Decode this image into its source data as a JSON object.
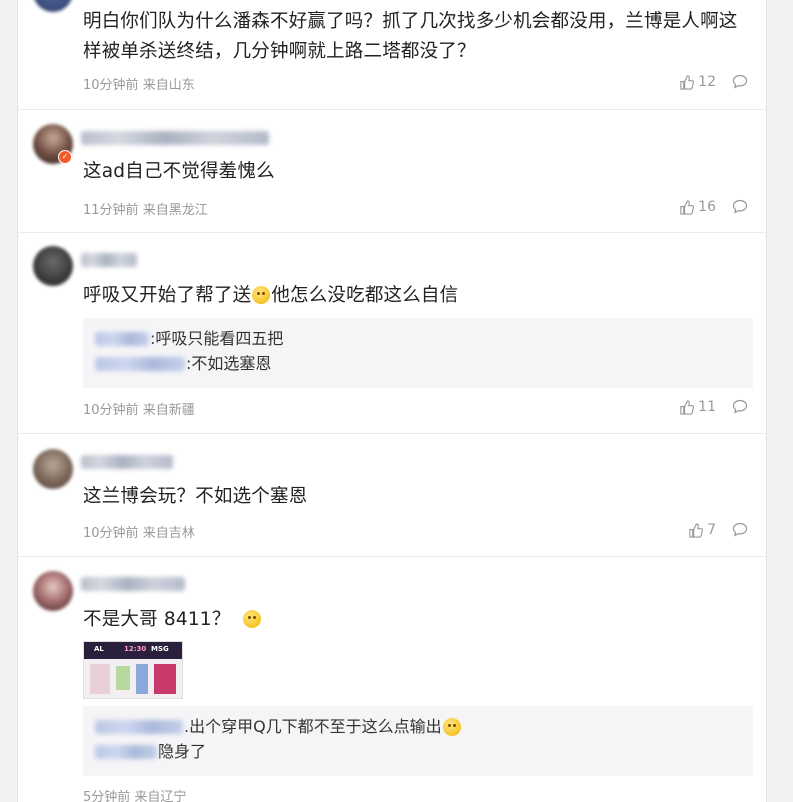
{
  "comments": [
    {
      "text": "明白你们队为什么潘森不好赢了吗？抓了几次找多少机会都没用，兰博是人啊这样被单杀送终结，几分钟啊就上路二塔都没了？",
      "time": "10分钟前",
      "location": "来自山东",
      "likes": "12"
    },
    {
      "text": "这ad自己不觉得羞愧么",
      "time": "11分钟前",
      "location": "来自黑龙江",
      "likes": "16"
    },
    {
      "text_a": "呼吸又开始了帮了送",
      "text_b": "他怎么没吃都这么自信",
      "replies": [
        ":呼吸只能看四五把",
        ":不如选塞恩"
      ],
      "time": "10分钟前",
      "location": "来自新疆",
      "likes": "11"
    },
    {
      "text": "这兰博会玩？不如选个塞恩",
      "time": "10分钟前",
      "location": "来自吉林",
      "likes": "7"
    },
    {
      "text": "不是大哥 8411？",
      "image_labels": [
        "AL",
        "12:30",
        "MSG"
      ],
      "replies": [
        ".出个穿甲Q几下都不至于这么点输出",
        "隐身了"
      ],
      "time": "5分钟前",
      "location": "来自辽宁"
    }
  ],
  "icons": {
    "like": "thumbs-up-icon",
    "reply": "comment-bubble-icon"
  },
  "colors": {
    "meta": "#999999",
    "badge": "#f55a2c",
    "quote_bg": "#f5f5f7"
  }
}
